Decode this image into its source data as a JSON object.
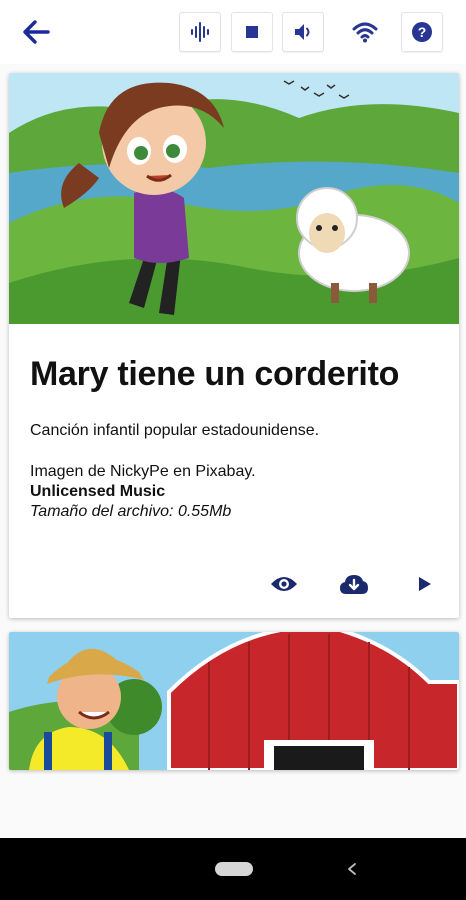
{
  "colors": {
    "accent": "#1a2a9c",
    "icon_dark": "#283593",
    "nav_bg": "#000000"
  },
  "toolbar": {
    "back_icon": "arrow-left-icon",
    "buttons": [
      {
        "icon": "voice-waveform-icon"
      },
      {
        "icon": "stop-icon"
      },
      {
        "icon": "volume-icon"
      },
      {
        "icon": "wifi-icon"
      },
      {
        "icon": "help-icon"
      }
    ]
  },
  "cards": [
    {
      "title": "Mary tiene un corderito",
      "description": "Canción infantil popular estadounidense.",
      "credit": "Imagen de NickyPe en Pixabay.",
      "license": "Unlicensed Music",
      "file_size": "Tamaño del archivo: 0.55Mb",
      "actions": [
        {
          "icon": "eye-icon"
        },
        {
          "icon": "cloud-download-icon"
        },
        {
          "icon": "play-icon"
        }
      ]
    },
    {
      "image": "farmer-barn-illustration"
    }
  ],
  "navbar": {
    "home_icon": "home-pill-icon",
    "back_icon": "nav-back-icon"
  }
}
